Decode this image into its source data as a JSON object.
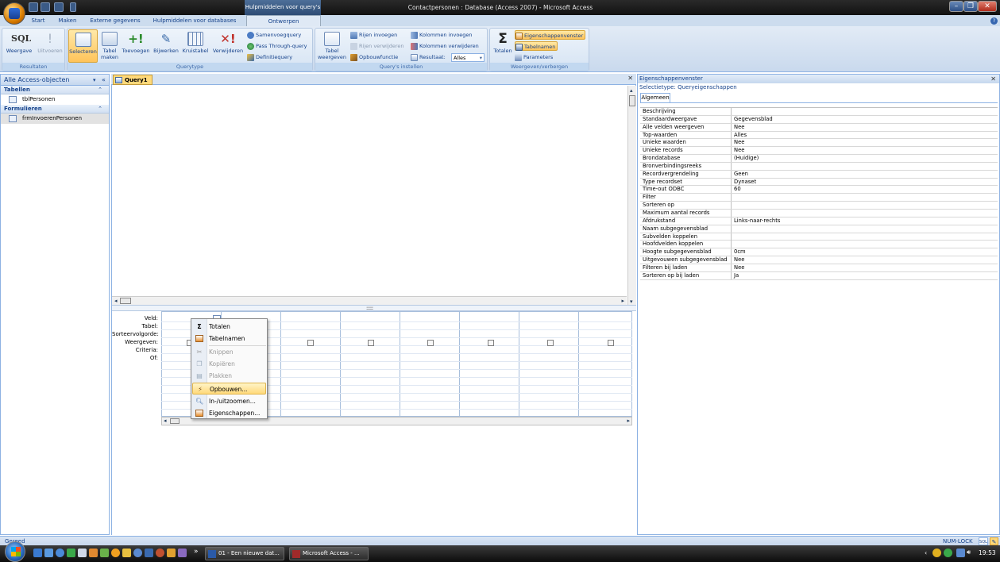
{
  "window": {
    "title": "Contactpersonen : Database (Access 2007) - Microsoft Access",
    "context_tab": "Hulpmiddelen voor query's"
  },
  "tabs": [
    "Start",
    "Maken",
    "Externe gegevens",
    "Hulpmiddelen voor databases",
    "Ontwerpen"
  ],
  "ribbon": {
    "results": {
      "label": "Resultaten",
      "view": "Weergave",
      "run": "Uitvoeren",
      "sql": "SQL"
    },
    "querytype": {
      "label": "Querytype",
      "select": "Selecteren",
      "make_table": "Tabel maken",
      "append": "Toevoegen",
      "update": "Bijwerken",
      "crosstab": "Kruistabel",
      "delete": "Verwijderen",
      "union": "Samenvoegquery",
      "passthrough": "Pass Through-query",
      "definition": "Definitiequery"
    },
    "setup": {
      "label": "Query's instellen",
      "show_table": "Tabel weergeven",
      "insert_rows": "Rijen invoegen",
      "delete_rows": "Rijen verwijderen",
      "builder": "Opbouwfunctie",
      "insert_cols": "Kolommen invoegen",
      "delete_cols": "Kolommen verwijderen",
      "return_label": "Resultaat:",
      "return_value": "Alles"
    },
    "showhide": {
      "label": "Weergeven/verbergen",
      "totals": "Totalen",
      "property_sheet": "Eigenschappenvenster",
      "table_names": "Tabelnamen",
      "parameters": "Parameters"
    }
  },
  "nav": {
    "header": "Alle Access-objecten",
    "sections": [
      {
        "title": "Tabellen",
        "items": [
          "tblPersonen"
        ]
      },
      {
        "title": "Formulieren",
        "items": [
          "frmInvoerenPersonen"
        ]
      }
    ]
  },
  "document": {
    "tab": "Query1"
  },
  "grid": {
    "row_labels": [
      "Veld:",
      "Tabel:",
      "Sorteervolgorde:",
      "Weergeven:",
      "Criteria:",
      "Of:"
    ]
  },
  "context_menu": {
    "items": [
      {
        "label": "Totalen",
        "icon": "sigma-icon",
        "enabled": true
      },
      {
        "label": "Tabelnamen",
        "icon": "table-names-icon",
        "enabled": true
      },
      {
        "label": "Knippen",
        "icon": "scissors-icon",
        "enabled": false
      },
      {
        "label": "Kopiëren",
        "icon": "copy-icon",
        "enabled": false
      },
      {
        "label": "Plakken",
        "icon": "paste-icon",
        "enabled": false
      },
      {
        "label": "Opbouwen...",
        "icon": "builder-icon",
        "enabled": true,
        "highlighted": true
      },
      {
        "label": "In-/uitzoomen...",
        "icon": "zoom-icon",
        "enabled": true
      },
      {
        "label": "Eigenschappen...",
        "icon": "properties-icon",
        "enabled": true
      }
    ]
  },
  "property_sheet": {
    "title": "Eigenschappenvenster",
    "selection_label": "Selectietype:",
    "selection_value": "Queryeigenschappen",
    "tab": "Algemeen",
    "rows": [
      {
        "k": "Beschrijving",
        "v": ""
      },
      {
        "k": "Standaardweergave",
        "v": "Gegevensblad"
      },
      {
        "k": "Alle velden weergeven",
        "v": "Nee"
      },
      {
        "k": "Top-waarden",
        "v": "Alles"
      },
      {
        "k": "Unieke waarden",
        "v": "Nee"
      },
      {
        "k": "Unieke records",
        "v": "Nee"
      },
      {
        "k": "Brondatabase",
        "v": "(Huidige)"
      },
      {
        "k": "Bronverbindingsreeks",
        "v": ""
      },
      {
        "k": "Recordvergrendeling",
        "v": "Geen"
      },
      {
        "k": "Type recordset",
        "v": "Dynaset"
      },
      {
        "k": "Time-out ODBC",
        "v": "60"
      },
      {
        "k": "Filter",
        "v": ""
      },
      {
        "k": "Sorteren op",
        "v": ""
      },
      {
        "k": "Maximum aantal records",
        "v": ""
      },
      {
        "k": "Afdrukstand",
        "v": "Links-naar-rechts"
      },
      {
        "k": "Naam subgegevensblad",
        "v": ""
      },
      {
        "k": "Subvelden koppelen",
        "v": ""
      },
      {
        "k": "Hoofdvelden koppelen",
        "v": ""
      },
      {
        "k": "Hoogte subgegevensblad",
        "v": "0cm"
      },
      {
        "k": "Uitgevouwen subgegevensblad",
        "v": "Nee"
      },
      {
        "k": "Filteren bij laden",
        "v": "Nee"
      },
      {
        "k": "Sorteren op bij laden",
        "v": "Ja"
      }
    ]
  },
  "status": {
    "left": "Gereed",
    "numlock": "NUM-LOCK",
    "sql": "SQL"
  },
  "taskbar": {
    "buttons": [
      "01 - Een nieuwe dat...",
      "Microsoft Access - ..."
    ],
    "chevron": "»",
    "clock": "19:53"
  }
}
